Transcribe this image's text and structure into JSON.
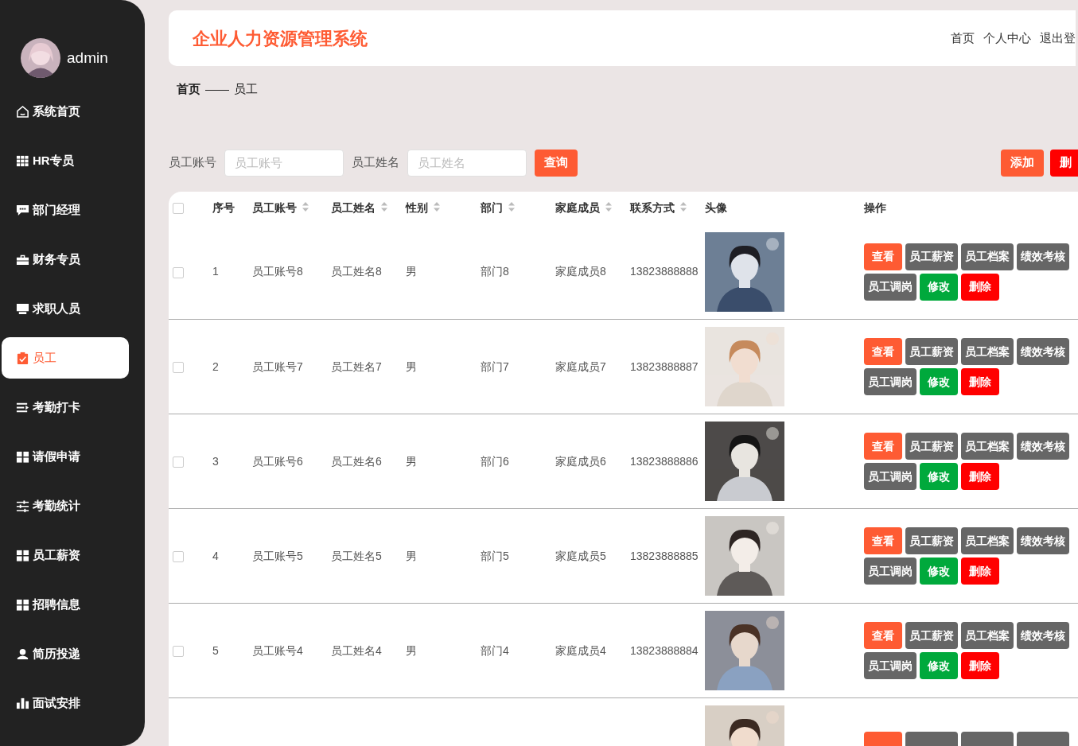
{
  "sidebar": {
    "user": {
      "name": "admin"
    },
    "items": [
      {
        "label": "系统首页",
        "selected": false
      },
      {
        "label": "HR专员",
        "selected": false
      },
      {
        "label": "部门经理",
        "selected": false
      },
      {
        "label": "财务专员",
        "selected": false
      },
      {
        "label": "求职人员",
        "selected": false
      },
      {
        "label": "员工",
        "selected": true
      },
      {
        "label": "考勤打卡",
        "selected": false
      },
      {
        "label": "请假申请",
        "selected": false
      },
      {
        "label": "考勤统计",
        "selected": false
      },
      {
        "label": "员工薪资",
        "selected": false
      },
      {
        "label": "招聘信息",
        "selected": false
      },
      {
        "label": "简历投递",
        "selected": false
      },
      {
        "label": "面试安排",
        "selected": false
      }
    ]
  },
  "header": {
    "title": "企业人力资源管理系统",
    "links": [
      "首页",
      "个人中心",
      "退出登"
    ]
  },
  "breadcrumb": {
    "items": [
      "首页",
      "员工"
    ],
    "separator": "——"
  },
  "search": {
    "fields": [
      {
        "label": "员工账号",
        "placeholder": "员工账号"
      },
      {
        "label": "员工姓名",
        "placeholder": "员工姓名"
      }
    ],
    "button": "查询",
    "actions": [
      {
        "label": "添加",
        "kind": "primary"
      },
      {
        "label": "删",
        "kind": "danger"
      }
    ]
  },
  "table": {
    "select_all": {
      "checked": false
    },
    "columns": [
      {
        "label": "序号",
        "sortable": false
      },
      {
        "label": "员工账号",
        "sortable": true
      },
      {
        "label": "员工姓名",
        "sortable": true
      },
      {
        "label": "性别",
        "sortable": true
      },
      {
        "label": "部门",
        "sortable": true
      },
      {
        "label": "家庭成员",
        "sortable": true
      },
      {
        "label": "联系方式",
        "sortable": true
      },
      {
        "label": "头像",
        "sortable": false
      },
      {
        "label": "操作",
        "sortable": false
      }
    ],
    "rows": [
      {
        "checked": false,
        "cells": [
          "1",
          "员工账号8",
          "员工姓名8",
          "男",
          "部门8",
          "家庭成员8",
          "13823888888"
        ],
        "actions": [
          {
            "label": "查看",
            "kind": "primary"
          },
          {
            "label": "员工薪资",
            "kind": "secondary"
          },
          {
            "label": "员工档案",
            "kind": "secondary"
          },
          {
            "label": "绩效考核",
            "kind": "secondary"
          },
          {
            "label": "员工调岗",
            "kind": "secondary"
          },
          {
            "label": "修改",
            "kind": "success"
          },
          {
            "label": "删除",
            "kind": "danger"
          }
        ]
      },
      {
        "checked": false,
        "cells": [
          "2",
          "员工账号7",
          "员工姓名7",
          "男",
          "部门7",
          "家庭成员7",
          "13823888887"
        ],
        "actions": [
          {
            "label": "查看",
            "kind": "primary"
          },
          {
            "label": "员工薪资",
            "kind": "secondary"
          },
          {
            "label": "员工档案",
            "kind": "secondary"
          },
          {
            "label": "绩效考核",
            "kind": "secondary"
          },
          {
            "label": "员工调岗",
            "kind": "secondary"
          },
          {
            "label": "修改",
            "kind": "success"
          },
          {
            "label": "删除",
            "kind": "danger"
          }
        ]
      },
      {
        "checked": false,
        "cells": [
          "3",
          "员工账号6",
          "员工姓名6",
          "男",
          "部门6",
          "家庭成员6",
          "13823888886"
        ],
        "actions": [
          {
            "label": "查看",
            "kind": "primary"
          },
          {
            "label": "员工薪资",
            "kind": "secondary"
          },
          {
            "label": "员工档案",
            "kind": "secondary"
          },
          {
            "label": "绩效考核",
            "kind": "secondary"
          },
          {
            "label": "员工调岗",
            "kind": "secondary"
          },
          {
            "label": "修改",
            "kind": "success"
          },
          {
            "label": "删除",
            "kind": "danger"
          }
        ]
      },
      {
        "checked": false,
        "cells": [
          "4",
          "员工账号5",
          "员工姓名5",
          "男",
          "部门5",
          "家庭成员5",
          "13823888885"
        ],
        "actions": [
          {
            "label": "查看",
            "kind": "primary"
          },
          {
            "label": "员工薪资",
            "kind": "secondary"
          },
          {
            "label": "员工档案",
            "kind": "secondary"
          },
          {
            "label": "绩效考核",
            "kind": "secondary"
          },
          {
            "label": "员工调岗",
            "kind": "secondary"
          },
          {
            "label": "修改",
            "kind": "success"
          },
          {
            "label": "删除",
            "kind": "danger"
          }
        ]
      },
      {
        "checked": false,
        "cells": [
          "5",
          "员工账号4",
          "员工姓名4",
          "男",
          "部门4",
          "家庭成员4",
          "13823888884"
        ],
        "actions": [
          {
            "label": "查看",
            "kind": "primary"
          },
          {
            "label": "员工薪资",
            "kind": "secondary"
          },
          {
            "label": "员工档案",
            "kind": "secondary"
          },
          {
            "label": "绩效考核",
            "kind": "secondary"
          },
          {
            "label": "员工调岗",
            "kind": "secondary"
          },
          {
            "label": "修改",
            "kind": "success"
          },
          {
            "label": "删除",
            "kind": "danger"
          }
        ]
      },
      {
        "actions": [
          {
            "kind": "primary"
          },
          {
            "kind": "secondary"
          },
          {
            "kind": "secondary"
          },
          {
            "kind": "secondary"
          }
        ]
      }
    ]
  }
}
